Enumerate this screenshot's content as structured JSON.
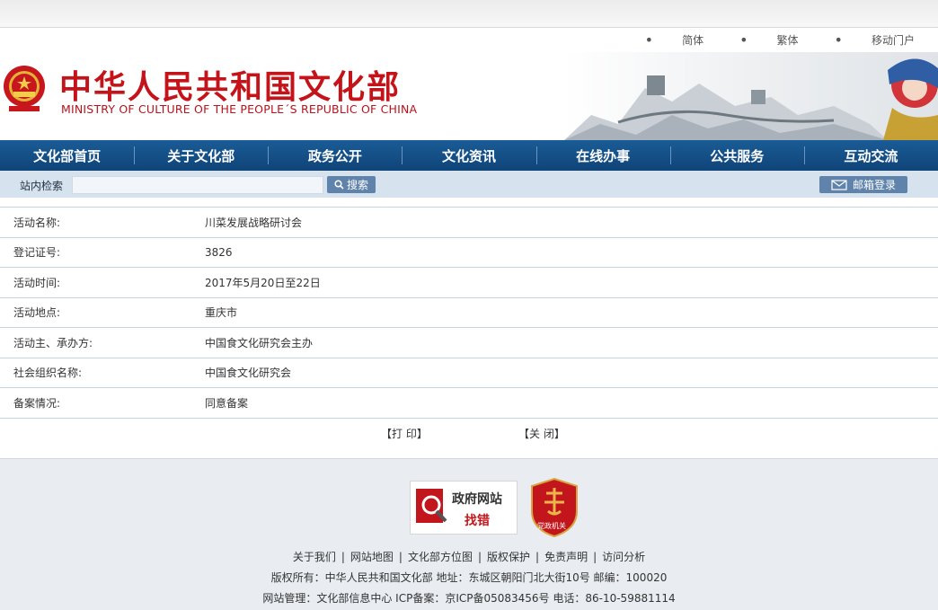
{
  "toplinks": {
    "simplified": "简体",
    "traditional": "繁体",
    "mobile": "移动门户"
  },
  "header": {
    "title_cn": "中华人民共和国文化部",
    "title_en": "MINISTRY OF CULTURE OF THE PEOPLE´S REPUBLIC OF CHINA"
  },
  "nav": [
    "文化部首页",
    "关于文化部",
    "政务公开",
    "文化资讯",
    "在线办事",
    "公共服务",
    "互动交流"
  ],
  "search": {
    "label": "站内检索",
    "placeholder": "",
    "button": "搜索",
    "mail_button": "邮箱登录"
  },
  "details": [
    {
      "label": "活动名称:",
      "value": "川菜发展战略研讨会"
    },
    {
      "label": "登记证号:",
      "value": "3826"
    },
    {
      "label": "活动时间:",
      "value": "2017年5月20日至22日"
    },
    {
      "label": "活动地点:",
      "value": "重庆市"
    },
    {
      "label": "活动主、承办方:",
      "value": "中国食文化研究会主办"
    },
    {
      "label": "社会组织名称:",
      "value": "中国食文化研究会"
    },
    {
      "label": "备案情况:",
      "value": "同意备案"
    }
  ],
  "actions": {
    "print": "【打 印】",
    "close": "【关 闭】"
  },
  "footer": {
    "badge1_line1": "政府网站",
    "badge1_line2": "找错",
    "badge2_text": "党政机关",
    "links": [
      "关于我们",
      "|",
      "网站地图",
      "|",
      "文化部方位图",
      "|",
      "版权保护",
      "|",
      "免责声明",
      "|",
      "访问分析"
    ],
    "copyright": "版权所有：中华人民共和国文化部 地址：东城区朝阳门北大街10号 邮编：100020",
    "management": "网站管理：文化部信息中心 ICP备案：京ICP备05083456号 电话：86-10-59881114"
  },
  "colors": {
    "brand_red": "#c4141a",
    "nav_blue": "#0f4478",
    "search_bg": "#d6e2ee"
  }
}
